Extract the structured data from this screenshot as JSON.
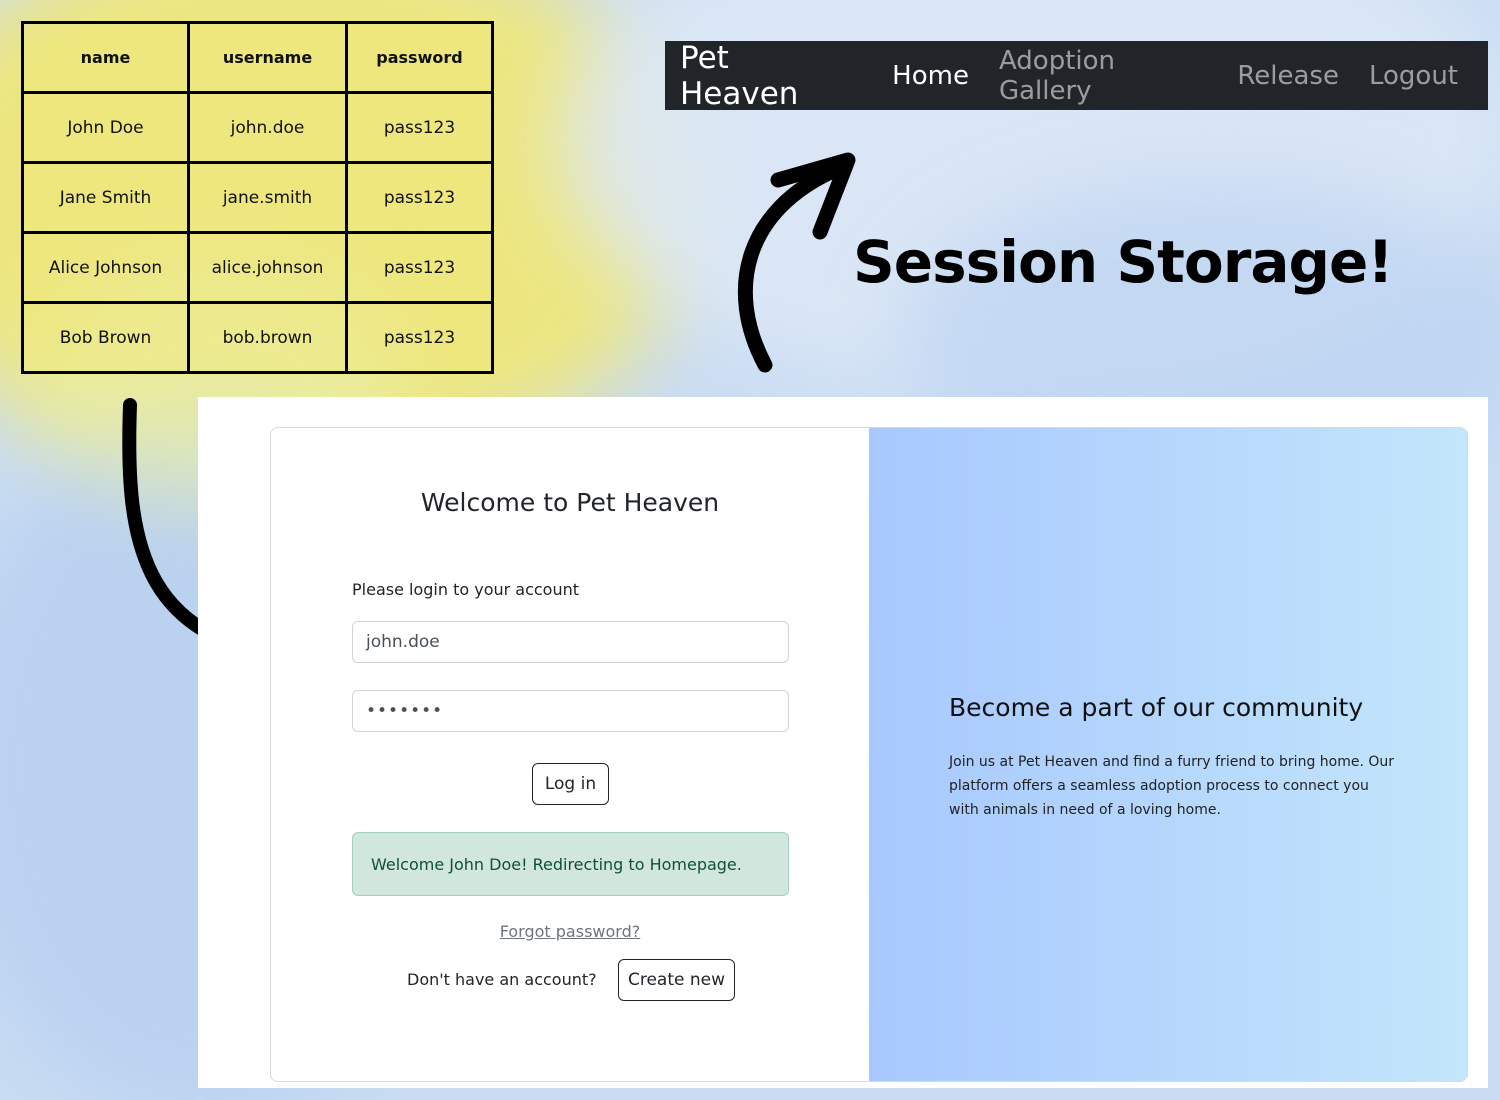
{
  "users_table": {
    "headers": [
      "name",
      "username",
      "password"
    ],
    "rows": [
      [
        "John Doe",
        "john.doe",
        "pass123"
      ],
      [
        "Jane Smith",
        "jane.smith",
        "pass123"
      ],
      [
        "Alice Johnson",
        "alice.johnson",
        "pass123"
      ],
      [
        "Bob Brown",
        "bob.brown",
        "pass123"
      ]
    ]
  },
  "navbar": {
    "brand": "Pet Heaven",
    "links": [
      {
        "label": "Home",
        "active": true
      },
      {
        "label": "Adoption Gallery",
        "active": false
      },
      {
        "label": "Release",
        "active": false
      },
      {
        "label": "Logout",
        "active": false
      }
    ]
  },
  "caption": "Session Storage!",
  "login": {
    "title": "Welcome to Pet Heaven",
    "subtitle": "Please login to your account",
    "username_value": "john.doe",
    "password_value": "•••••••",
    "login_button": "Log in",
    "alert": "Welcome John Doe! Redirecting to Homepage.",
    "forgot": "Forgot password?",
    "no_account": "Don't have an account?",
    "create_button": "Create new"
  },
  "promo": {
    "title": "Become a part of our community",
    "text": "Join us at Pet Heaven and find a furry friend to bring home. Our platform offers a seamless adoption process to connect you with animals in need of a loving home."
  },
  "colors": {
    "navbar_bg": "#212529",
    "alert_bg": "#d1e7dd",
    "promo_gradient_start": "#a7c8fe",
    "promo_gradient_end": "#c3e6fb"
  }
}
